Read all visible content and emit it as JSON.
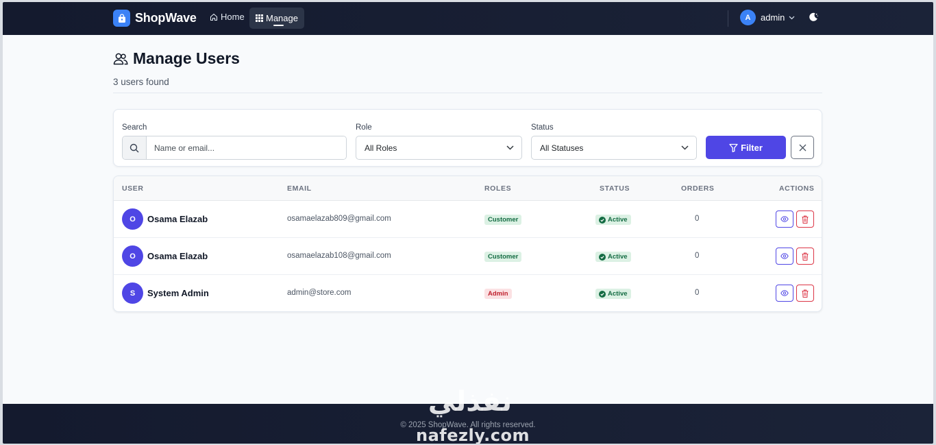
{
  "navbar": {
    "brand": "ShopWave",
    "home_label": "Home",
    "manage_label": "Manage",
    "user_initial": "A",
    "username": "admin"
  },
  "page": {
    "title": "Manage Users",
    "subtitle": "3 users found"
  },
  "filters": {
    "search_label": "Search",
    "search_placeholder": "Name or email...",
    "search_value": "",
    "role_label": "Role",
    "role_selected": "All Roles",
    "status_label": "Status",
    "status_selected": "All Statuses",
    "filter_button": "Filter"
  },
  "table": {
    "columns": [
      "USER",
      "EMAIL",
      "ROLES",
      "STATUS",
      "ORDERS",
      "ACTIONS"
    ],
    "rows": [
      {
        "initial": "O",
        "name": "Osama Elazab",
        "email": "osamaelazab809@gmail.com",
        "role": "Customer",
        "status": "Active",
        "orders": "0"
      },
      {
        "initial": "O",
        "name": "Osama Elazab",
        "email": "osamaelazab108@gmail.com",
        "role": "Customer",
        "status": "Active",
        "orders": "0"
      },
      {
        "initial": "S",
        "name": "System Admin",
        "email": "admin@store.com",
        "role": "Admin",
        "status": "Active",
        "orders": "0"
      }
    ]
  },
  "footer": {
    "text": "© 2025 ShopWave. All rights reserved."
  },
  "watermark": {
    "arabic": "نفذلي",
    "latin": "nafezly.com"
  },
  "colors": {
    "nav_bg": "#141a2e",
    "primary": "#4f46e5",
    "brand_blue": "#3b82f6",
    "success": "#146c43",
    "danger": "#dc3545"
  },
  "icons": {
    "brand": "shopping-bag-icon",
    "home": "home-icon",
    "manage": "grid-icon",
    "theme": "moon-icon",
    "title": "users-icon",
    "search": "search-icon",
    "filter": "filter-icon",
    "clear": "close-icon",
    "view": "eye-icon",
    "delete": "trash-icon",
    "status": "check-circle-icon"
  }
}
